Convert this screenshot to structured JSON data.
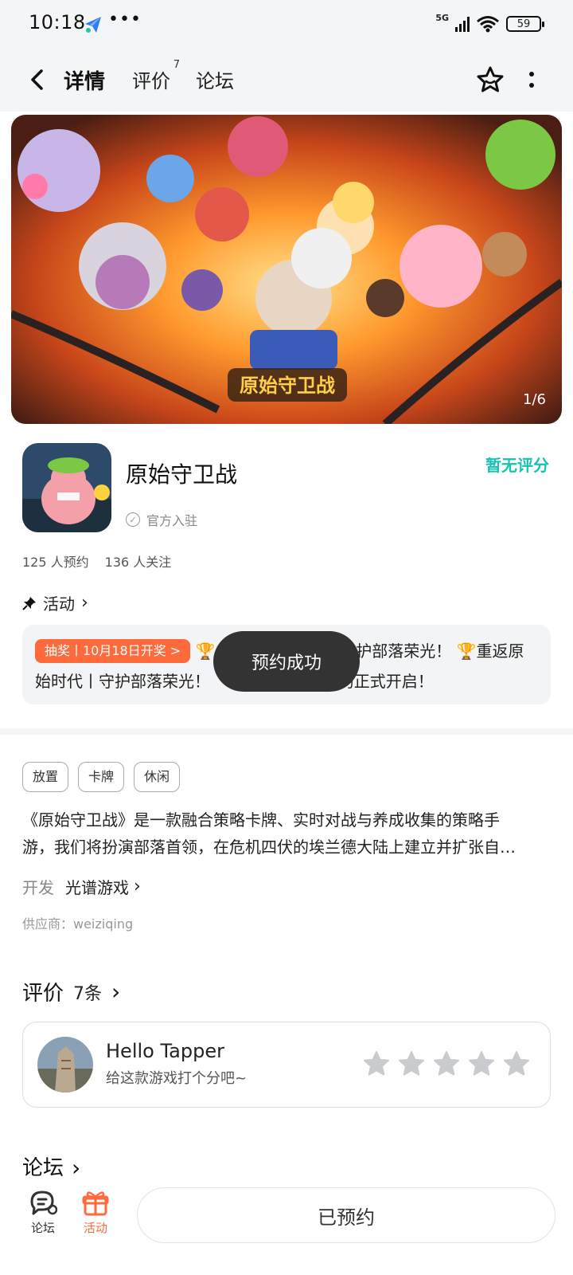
{
  "status_bar": {
    "time": "10:18",
    "dots": "•••",
    "network": "5G",
    "battery": "59"
  },
  "nav": {
    "tabs": [
      {
        "label": "详情",
        "active": true
      },
      {
        "label": "评价",
        "badge": "7"
      },
      {
        "label": "论坛"
      }
    ],
    "accent": "#16c1b5"
  },
  "banner": {
    "counter": "1/6",
    "title_art": "原始守卫战"
  },
  "app": {
    "name": "原始守卫战",
    "official_label": "官方入驻",
    "rating_text": "暂无评分",
    "reservations": "125 人预约",
    "followers": "136 人关注"
  },
  "activity": {
    "header": "活动",
    "tag": "抽奖丨10月18日开奖 >",
    "text_line1_suffix": "护部落荣光！",
    "text_line1_end": "重返原",
    "text_line2_start": "始时代丨守护部落荣光！",
    "text_line2_end": "约正式开启！"
  },
  "toast": "预约成功",
  "tags": [
    "放置",
    "卡牌",
    "休闲"
  ],
  "description": {
    "line1": "《原始守卫战》是一款融合策略卡牌、实时对战与养成收集的策略手",
    "line2": "游，我们将扮演部落首领，在危机四伏的埃兰德大陆上建立并扩张自…"
  },
  "developer": {
    "label": "开发",
    "name": "光谱游戏"
  },
  "supplier": "供应商：weiziqing",
  "reviews": {
    "title": "评价",
    "count": "7条",
    "user_name": "Hello Tapper",
    "prompt": "给这款游戏打个分吧~",
    "stars": 5
  },
  "forum": {
    "title": "论坛"
  },
  "bottom_bar": {
    "forum_label": "论坛",
    "activity_label": "活动",
    "reserved_label": "已预约",
    "activity_color": "#ff6a3d"
  }
}
